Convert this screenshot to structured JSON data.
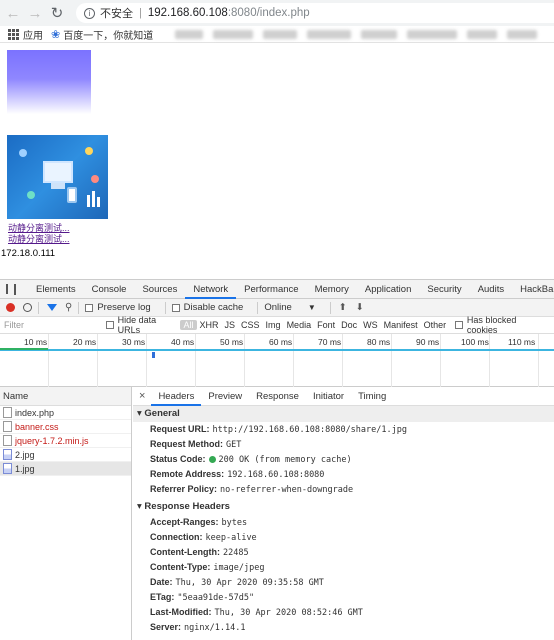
{
  "browser": {
    "security_label": "不安全",
    "url_host": "192.168.60.108",
    "url_path": ":8080/index.php",
    "bookmarks": [
      "应用",
      "百度一下，你就知道"
    ]
  },
  "page": {
    "links": [
      "动静分离测试...",
      "动静分离测试..."
    ],
    "ip_text": "172.18.0.111"
  },
  "devtools": {
    "tabs": [
      "Elements",
      "Console",
      "Sources",
      "Network",
      "Performance",
      "Memory",
      "Application",
      "Security",
      "Audits",
      "HackBar"
    ],
    "active_tab": "Network",
    "toolbar": {
      "preserve_log": "Preserve log",
      "disable_cache": "Disable cache",
      "throttle": "Online"
    },
    "filter": {
      "placeholder": "Filter",
      "hide_data_urls": "Hide data URLs",
      "types": [
        "All",
        "XHR",
        "JS",
        "CSS",
        "Img",
        "Media",
        "Font",
        "Doc",
        "WS",
        "Manifest",
        "Other"
      ],
      "blocked": "Has blocked cookies"
    },
    "timeline_ticks": [
      "10 ms",
      "20 ms",
      "30 ms",
      "40 ms",
      "50 ms",
      "60 ms",
      "70 ms",
      "80 ms",
      "90 ms",
      "100 ms",
      "110 ms"
    ],
    "requests": {
      "header": "Name",
      "rows": [
        {
          "name": "index.php",
          "kind": "doc",
          "error": false
        },
        {
          "name": "banner.css",
          "kind": "doc",
          "error": true
        },
        {
          "name": "jquery-1.7.2.min.js",
          "kind": "doc",
          "error": true
        },
        {
          "name": "2.jpg",
          "kind": "img",
          "error": false
        },
        {
          "name": "1.jpg",
          "kind": "img",
          "error": false
        }
      ]
    },
    "detail_tabs": [
      "Headers",
      "Preview",
      "Response",
      "Initiator",
      "Timing"
    ],
    "general": {
      "title": "General",
      "items": [
        {
          "k": "Request URL:",
          "v": "http://192.168.60.108:8080/share/1.jpg"
        },
        {
          "k": "Request Method:",
          "v": "GET"
        },
        {
          "k": "Status Code:",
          "v": "200 OK (from memory cache)"
        },
        {
          "k": "Remote Address:",
          "v": "192.168.60.108:8080"
        },
        {
          "k": "Referrer Policy:",
          "v": "no-referrer-when-downgrade"
        }
      ]
    },
    "response_headers": {
      "title": "Response Headers",
      "items": [
        {
          "k": "Accept-Ranges:",
          "v": "bytes"
        },
        {
          "k": "Connection:",
          "v": "keep-alive"
        },
        {
          "k": "Content-Length:",
          "v": "22485"
        },
        {
          "k": "Content-Type:",
          "v": "image/jpeg"
        },
        {
          "k": "Date:",
          "v": "Thu, 30 Apr 2020 09:35:58 GMT"
        },
        {
          "k": "ETag:",
          "v": "\"5eaa91de-57d5\""
        },
        {
          "k": "Last-Modified:",
          "v": "Thu, 30 Apr 2020 08:52:46 GMT"
        },
        {
          "k": "Server:",
          "v": "nginx/1.14.1"
        }
      ]
    }
  },
  "colors": {
    "accent": "#1a73e8",
    "record": "#d93025",
    "status_ok": "#34a853",
    "error_text": "#c41a16"
  }
}
